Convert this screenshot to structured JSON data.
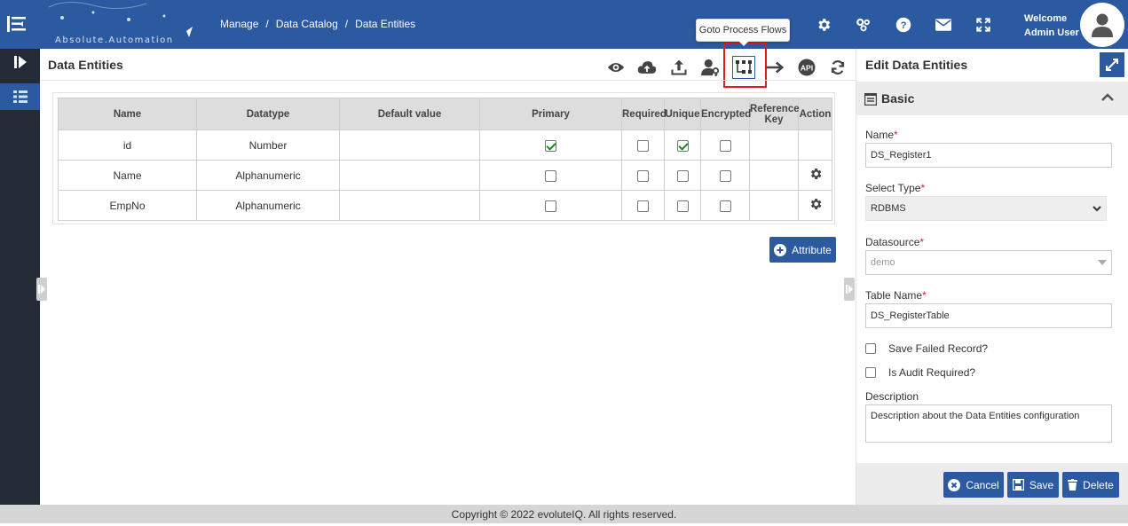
{
  "header": {
    "logo_text": "Absolute.Automation",
    "breadcrumb": [
      "Manage",
      "Data Catalog",
      "Data Entities"
    ],
    "welcome_line1": "Welcome",
    "welcome_line2": "Admin User"
  },
  "tooltip": {
    "text": "Goto Process Flows"
  },
  "main": {
    "title": "Data Entities",
    "table": {
      "headers": [
        "Name",
        "Datatype",
        "Default value",
        "Primary",
        "Required",
        "Unique",
        "Encrypted",
        "Reference Key",
        "Action"
      ],
      "rows": [
        {
          "name": "id",
          "datatype": "Number",
          "default_value": "",
          "primary": true,
          "required": false,
          "unique": true,
          "encrypted": false,
          "action": false
        },
        {
          "name": "Name",
          "datatype": "Alphanumeric",
          "default_value": "",
          "primary": false,
          "required": false,
          "unique": false,
          "encrypted": false,
          "action": true
        },
        {
          "name": "EmpNo",
          "datatype": "Alphanumeric",
          "default_value": "",
          "primary": false,
          "required": false,
          "unique": false,
          "encrypted": false,
          "action": true
        }
      ]
    },
    "attribute_button": "Attribute"
  },
  "right_panel": {
    "title": "Edit Data Entities",
    "section_title": "Basic",
    "name_label": "Name",
    "name_value": "DS_Register1",
    "type_label": "Select Type",
    "type_value": "RDBMS",
    "datasource_label": "Datasource",
    "datasource_value": "demo",
    "table_name_label": "Table Name",
    "table_name_value": "DS_RegisterTable",
    "save_failed_label": "Save Failed Record?",
    "audit_label": "Is Audit Required?",
    "description_label": "Description",
    "description_value": "Description about the Data Entities configuration",
    "cancel_label": "Cancel",
    "save_label": "Save",
    "delete_label": "Delete"
  },
  "footer": {
    "copyright": "Copyright © 2022 evoluteIQ. All rights reserved."
  },
  "colors": {
    "primary": "#2c5aa0",
    "rail": "#222b36",
    "highlight": "#e21c1c",
    "check": "#1a8a1a"
  }
}
